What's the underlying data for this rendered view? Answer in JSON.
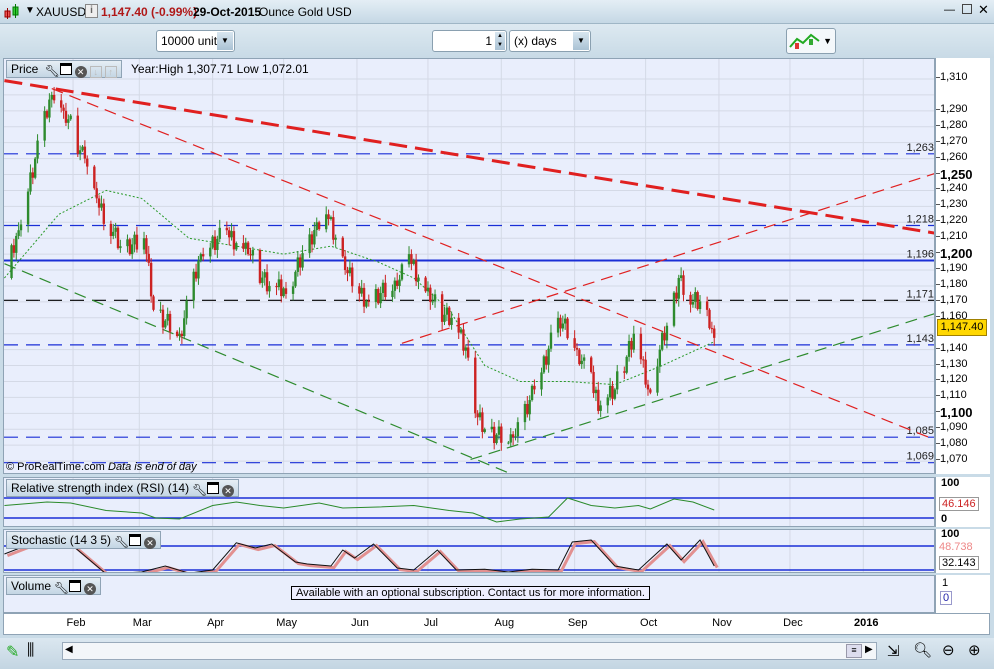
{
  "header": {
    "symbol": "XAUUSD",
    "price_change": "1,147.40 (-0.99%)",
    "date": "29-Oct-2015",
    "description": "Ounce Gold USD"
  },
  "toolbar": {
    "units": "10000 units",
    "quantity": "1",
    "period": "(x) days"
  },
  "price_panel": {
    "label": "Price",
    "info": "Year:High 1,307.71 Low 1,072.01",
    "copyright": "© ProRealTime.com",
    "data_note": "Data is end of day",
    "current_price": "1,147.40",
    "levels": [
      {
        "value": "1,263",
        "color": "#1a2fd6",
        "style": "dashed"
      },
      {
        "value": "1,218",
        "color": "#1a2fd6",
        "style": "dashed"
      },
      {
        "value": "1,196",
        "color": "#1a2fd6",
        "style": "solid"
      },
      {
        "value": "1,171",
        "color": "#000000",
        "style": "dashed"
      },
      {
        "value": "1,143",
        "color": "#1a2fd6",
        "style": "dashed"
      },
      {
        "value": "1,085",
        "color": "#1a2fd6",
        "style": "dashed"
      },
      {
        "value": "1,069",
        "color": "#1a2fd6",
        "style": "dashed"
      }
    ],
    "axis_ticks": [
      "1,310",
      "1,290",
      "1,280",
      "1,270",
      "1,260",
      "1,250",
      "1,240",
      "1,230",
      "1,220",
      "1,210",
      "1,200",
      "1,190",
      "1,180",
      "1,170",
      "1,160",
      "1,140",
      "1,130",
      "1,120",
      "1,110",
      "1,100",
      "1,090",
      "1,080",
      "1,070"
    ]
  },
  "rsi_panel": {
    "label": "Relative strength index (RSI) (14)",
    "top": "100",
    "bottom": "0",
    "value": "46.146"
  },
  "stoch_panel": {
    "label": "Stochastic (14 3 5)",
    "top": "100",
    "value1": "48.738",
    "value2": "32.143"
  },
  "volume_panel": {
    "label": "Volume",
    "message": "Available with an optional subscription. Contact us for more information.",
    "top": "1",
    "bottom": "0"
  },
  "months": [
    "Feb",
    "Mar",
    "Apr",
    "May",
    "Jun",
    "Jul",
    "Aug",
    "Sep",
    "Oct",
    "Nov",
    "Dec",
    "2016"
  ],
  "colors": {
    "up": "#2e8b2e",
    "down": "#cc2222",
    "level": "#1a2fd6",
    "price_tag": "#ffd700"
  },
  "chart_data": {
    "type": "candlestick",
    "title": "XAUUSD daily",
    "ylim": [
      1062,
      1318
    ],
    "x_unit": "day of 2015",
    "closes": [
      [
        2,
        1185
      ],
      [
        8,
        1215
      ],
      [
        15,
        1260
      ],
      [
        22,
        1300
      ],
      [
        27,
        1290
      ],
      [
        36,
        1260
      ],
      [
        41,
        1235
      ],
      [
        51,
        1205
      ],
      [
        61,
        1210
      ],
      [
        65,
        1165
      ],
      [
        76,
        1150
      ],
      [
        85,
        1200
      ],
      [
        96,
        1215
      ],
      [
        105,
        1200
      ],
      [
        114,
        1180
      ],
      [
        121,
        1175
      ],
      [
        134,
        1220
      ],
      [
        138,
        1225
      ],
      [
        146,
        1190
      ],
      [
        156,
        1170
      ],
      [
        168,
        1180
      ],
      [
        173,
        1200
      ],
      [
        182,
        1170
      ],
      [
        191,
        1160
      ],
      [
        198,
        1135
      ],
      [
        201,
        1100
      ],
      [
        205,
        1090
      ],
      [
        217,
        1085
      ],
      [
        226,
        1115
      ],
      [
        236,
        1160
      ],
      [
        244,
        1140
      ],
      [
        254,
        1105
      ],
      [
        260,
        1115
      ],
      [
        268,
        1150
      ],
      [
        274,
        1115
      ],
      [
        282,
        1155
      ],
      [
        287,
        1185
      ],
      [
        293,
        1170
      ],
      [
        299,
        1165
      ],
      [
        302,
        1147.4
      ]
    ],
    "moving_average": [
      [
        2,
        1185
      ],
      [
        25,
        1225
      ],
      [
        45,
        1240
      ],
      [
        60,
        1235
      ],
      [
        80,
        1210
      ],
      [
        100,
        1205
      ],
      [
        120,
        1200
      ],
      [
        140,
        1205
      ],
      [
        160,
        1195
      ],
      [
        175,
        1185
      ],
      [
        190,
        1165
      ],
      [
        205,
        1130
      ],
      [
        220,
        1120
      ],
      [
        240,
        1120
      ],
      [
        260,
        1118
      ],
      [
        280,
        1130
      ],
      [
        302,
        1145
      ]
    ],
    "trendlines": [
      {
        "from": [
          2,
          1309
        ],
        "to": [
          396,
          1213
        ],
        "color": "#e02020",
        "width": "thick"
      },
      {
        "from": [
          22,
          1304
        ],
        "to": [
          396,
          1083
        ],
        "color": "#e02020",
        "width": "thin"
      },
      {
        "from": [
          170,
          1144
        ],
        "to": [
          396,
          1251
        ],
        "color": "#e02020",
        "width": "thin"
      },
      {
        "from": [
          2,
          1194
        ],
        "to": [
          216,
          1062
        ],
        "color": "#2e8b2e",
        "width": "thin"
      },
      {
        "from": [
          199,
          1071
        ],
        "to": [
          396,
          1163
        ],
        "color": "#2e8b2e",
        "width": "thin"
      }
    ],
    "rsi": [
      [
        2,
        55
      ],
      [
        20,
        62
      ],
      [
        30,
        60
      ],
      [
        45,
        45
      ],
      [
        60,
        40
      ],
      [
        66,
        30
      ],
      [
        76,
        28
      ],
      [
        90,
        55
      ],
      [
        100,
        62
      ],
      [
        110,
        55
      ],
      [
        120,
        50
      ],
      [
        135,
        60
      ],
      [
        145,
        50
      ],
      [
        160,
        52
      ],
      [
        175,
        55
      ],
      [
        190,
        45
      ],
      [
        200,
        40
      ],
      [
        210,
        22
      ],
      [
        220,
        28
      ],
      [
        232,
        32
      ],
      [
        240,
        70
      ],
      [
        250,
        55
      ],
      [
        260,
        50
      ],
      [
        270,
        55
      ],
      [
        275,
        48
      ],
      [
        285,
        68
      ],
      [
        293,
        62
      ],
      [
        302,
        46
      ]
    ],
    "stochastic": [
      [
        2,
        60
      ],
      [
        15,
        90
      ],
      [
        30,
        85
      ],
      [
        45,
        10
      ],
      [
        60,
        15
      ],
      [
        70,
        30
      ],
      [
        80,
        12
      ],
      [
        90,
        20
      ],
      [
        100,
        88
      ],
      [
        108,
        75
      ],
      [
        115,
        85
      ],
      [
        125,
        40
      ],
      [
        130,
        35
      ],
      [
        140,
        30
      ],
      [
        145,
        70
      ],
      [
        150,
        50
      ],
      [
        158,
        85
      ],
      [
        168,
        25
      ],
      [
        175,
        20
      ],
      [
        185,
        70
      ],
      [
        193,
        20
      ],
      [
        205,
        22
      ],
      [
        215,
        15
      ],
      [
        225,
        22
      ],
      [
        236,
        20
      ],
      [
        242,
        90
      ],
      [
        250,
        95
      ],
      [
        260,
        30
      ],
      [
        270,
        20
      ],
      [
        282,
        85
      ],
      [
        288,
        45
      ],
      [
        296,
        95
      ],
      [
        302,
        30
      ]
    ]
  }
}
